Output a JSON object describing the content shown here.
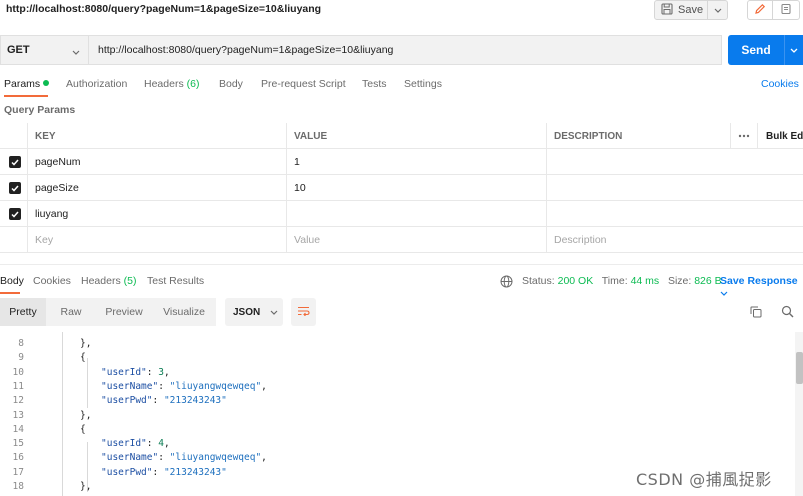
{
  "window": {
    "title_url": "http://localhost:8080/query?pageNum=1&pageSize=10&liuyang",
    "save_label": "Save"
  },
  "request": {
    "method": "GET",
    "url": "http://localhost:8080/query?pageNum=1&pageSize=10&liuyang",
    "send_label": "Send"
  },
  "request_tabs": {
    "params": "Params",
    "authorization": "Authorization",
    "headers": "Headers",
    "headers_count": "(6)",
    "body": "Body",
    "prerequest": "Pre-request Script",
    "tests": "Tests",
    "settings": "Settings",
    "cookies": "Cookies"
  },
  "query_params": {
    "title": "Query Params",
    "columns": {
      "key": "KEY",
      "value": "VALUE",
      "description": "DESCRIPTION",
      "bulk_edit": "Bulk Edit"
    },
    "rows": [
      {
        "key": "pageNum",
        "value": "1",
        "description": "",
        "checked": true
      },
      {
        "key": "pageSize",
        "value": "10",
        "description": "",
        "checked": true
      },
      {
        "key": "liuyang",
        "value": "",
        "description": "",
        "checked": true
      }
    ],
    "placeholders": {
      "key": "Key",
      "value": "Value",
      "description": "Description"
    }
  },
  "response_tabs": {
    "body": "Body",
    "cookies": "Cookies",
    "headers": "Headers",
    "headers_count": "(5)",
    "test_results": "Test Results"
  },
  "response_status": {
    "status_label": "Status:",
    "status_value": "200 OK",
    "time_label": "Time:",
    "time_value": "44 ms",
    "size_label": "Size:",
    "size_value": "826 B",
    "save_response": "Save Response"
  },
  "format_bar": {
    "pretty": "Pretty",
    "raw": "Raw",
    "preview": "Preview",
    "visualize": "Visualize",
    "format": "JSON"
  },
  "code": {
    "lines": [
      {
        "n": "8",
        "t": "},"
      },
      {
        "n": "9",
        "t": "{"
      },
      {
        "n": "10",
        "k": "\"userId\"",
        "v": "3",
        "vt": "num"
      },
      {
        "n": "11",
        "k": "\"userName\"",
        "v": "\"liuyangwqewqeq\"",
        "vt": "str"
      },
      {
        "n": "12",
        "k": "\"userPwd\"",
        "v": "\"213243243\"",
        "vt": "str",
        "last": true
      },
      {
        "n": "13",
        "t": "},"
      },
      {
        "n": "14",
        "t": "{"
      },
      {
        "n": "15",
        "k": "\"userId\"",
        "v": "4",
        "vt": "num"
      },
      {
        "n": "16",
        "k": "\"userName\"",
        "v": "\"liuyangwqewqeq\"",
        "vt": "str"
      },
      {
        "n": "17",
        "k": "\"userPwd\"",
        "v": "\"213243243\"",
        "vt": "str",
        "last": true
      },
      {
        "n": "18",
        "t": "},"
      }
    ]
  },
  "watermark": "CSDN @捕風捉影",
  "colors": {
    "accent_orange": "#f26b3a",
    "send_blue": "#097bed",
    "status_green": "#0cbb52"
  }
}
